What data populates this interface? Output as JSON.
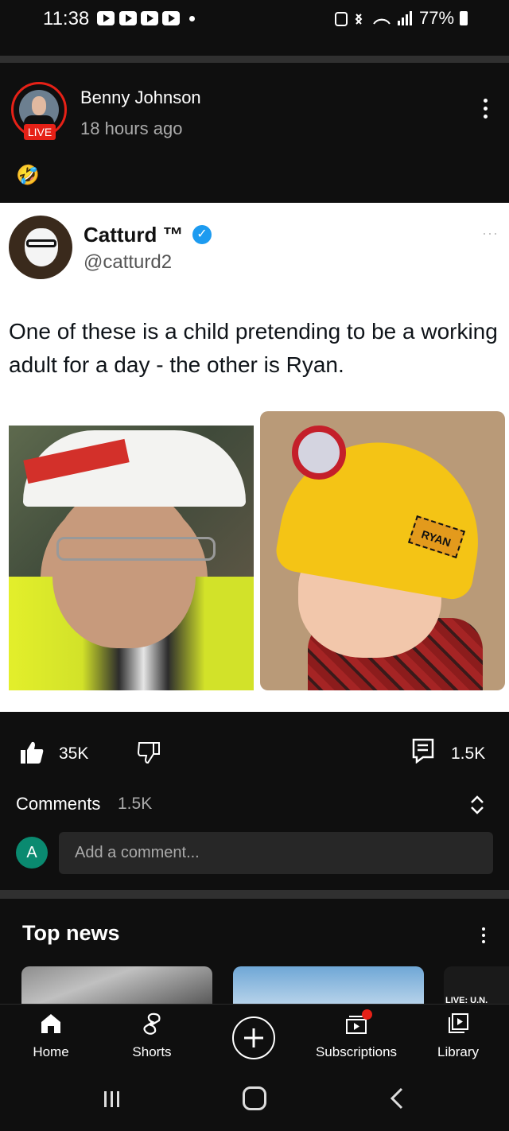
{
  "status_bar": {
    "time": "11:38",
    "battery": "77%"
  },
  "post": {
    "author": "Benny Johnson",
    "live_badge": "LIVE",
    "posted": "18 hours ago",
    "emoji": "🤣"
  },
  "tweet": {
    "name": "Catturd ™",
    "handle": "@catturd2",
    "text": "One of these is a child pretending to be a working adult for a day - the other is Ryan.",
    "hat_label": "RYAN",
    "more": "···"
  },
  "actions": {
    "likes": "35K",
    "comments": "1.5K"
  },
  "comments": {
    "label": "Comments",
    "count": "1.5K",
    "user_initial": "A",
    "placeholder": "Add a comment..."
  },
  "top_news": {
    "title": "Top news",
    "live_strip": "LIVE: U.N."
  },
  "nav": {
    "items": [
      {
        "label": "Home",
        "icon": "home-icon"
      },
      {
        "label": "Shorts",
        "icon": "shorts-icon"
      },
      {
        "label": "",
        "icon": "create-icon"
      },
      {
        "label": "Subscriptions",
        "icon": "subscriptions-icon"
      },
      {
        "label": "Library",
        "icon": "library-icon"
      }
    ]
  },
  "colors": {
    "live_red": "#e62117",
    "verified_blue": "#1d9bf0",
    "avatar_green": "#0a8a70"
  }
}
